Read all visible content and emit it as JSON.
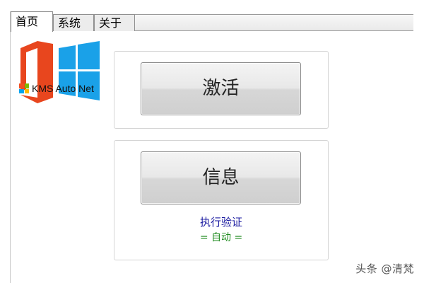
{
  "tabs": [
    {
      "label": "首页",
      "active": true
    },
    {
      "label": "系统",
      "active": false
    },
    {
      "label": "关于",
      "active": false
    }
  ],
  "logo": {
    "caption": "KMS Auto Net",
    "colors": {
      "office_orange": "#e8461e",
      "windows_blue": "#1aa1e8"
    }
  },
  "buttons": {
    "activate_label": "激活",
    "info_label": "信息"
  },
  "verify": {
    "link_label": "执行验证",
    "mode_label": "= 自动 ="
  },
  "watermark": "头条 @清梵",
  "colors": {
    "link": "#1a1aa0",
    "mode": "#1e8a1e"
  }
}
